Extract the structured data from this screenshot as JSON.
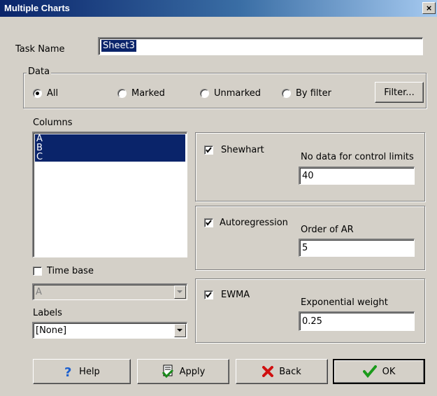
{
  "window": {
    "title": "Multiple Charts",
    "close_label": "×"
  },
  "task": {
    "label": "Task Name",
    "value": "Sheet3"
  },
  "data_group": {
    "label": "Data",
    "options": [
      "All",
      "Marked",
      "Unmarked",
      "By filter"
    ],
    "selected": "All",
    "filter_button": "Filter..."
  },
  "columns": {
    "label": "Columns",
    "items": [
      "A",
      "B",
      "C"
    ],
    "selected": [
      "A",
      "B",
      "C"
    ]
  },
  "time_base": {
    "label": "Time base",
    "checked": false,
    "combo_value": "A"
  },
  "labels": {
    "label": "Labels",
    "combo_value": "[None]"
  },
  "shewhart": {
    "label": "Shewhart",
    "checked": true,
    "field_label": "No data for control limits",
    "field_value": "40"
  },
  "autoregression": {
    "label": "Autoregression",
    "checked": true,
    "field_label": "Order of AR",
    "field_value": "5"
  },
  "ewma": {
    "label": "EWMA",
    "checked": true,
    "field_label": "Exponential weight",
    "field_value": "0.25"
  },
  "buttons": {
    "help": "Help",
    "apply": "Apply",
    "back": "Back",
    "ok": "OK"
  },
  "colors": {
    "title_bar": "#0a246a",
    "face": "#d4d0c8",
    "selection": "#0a246a"
  }
}
